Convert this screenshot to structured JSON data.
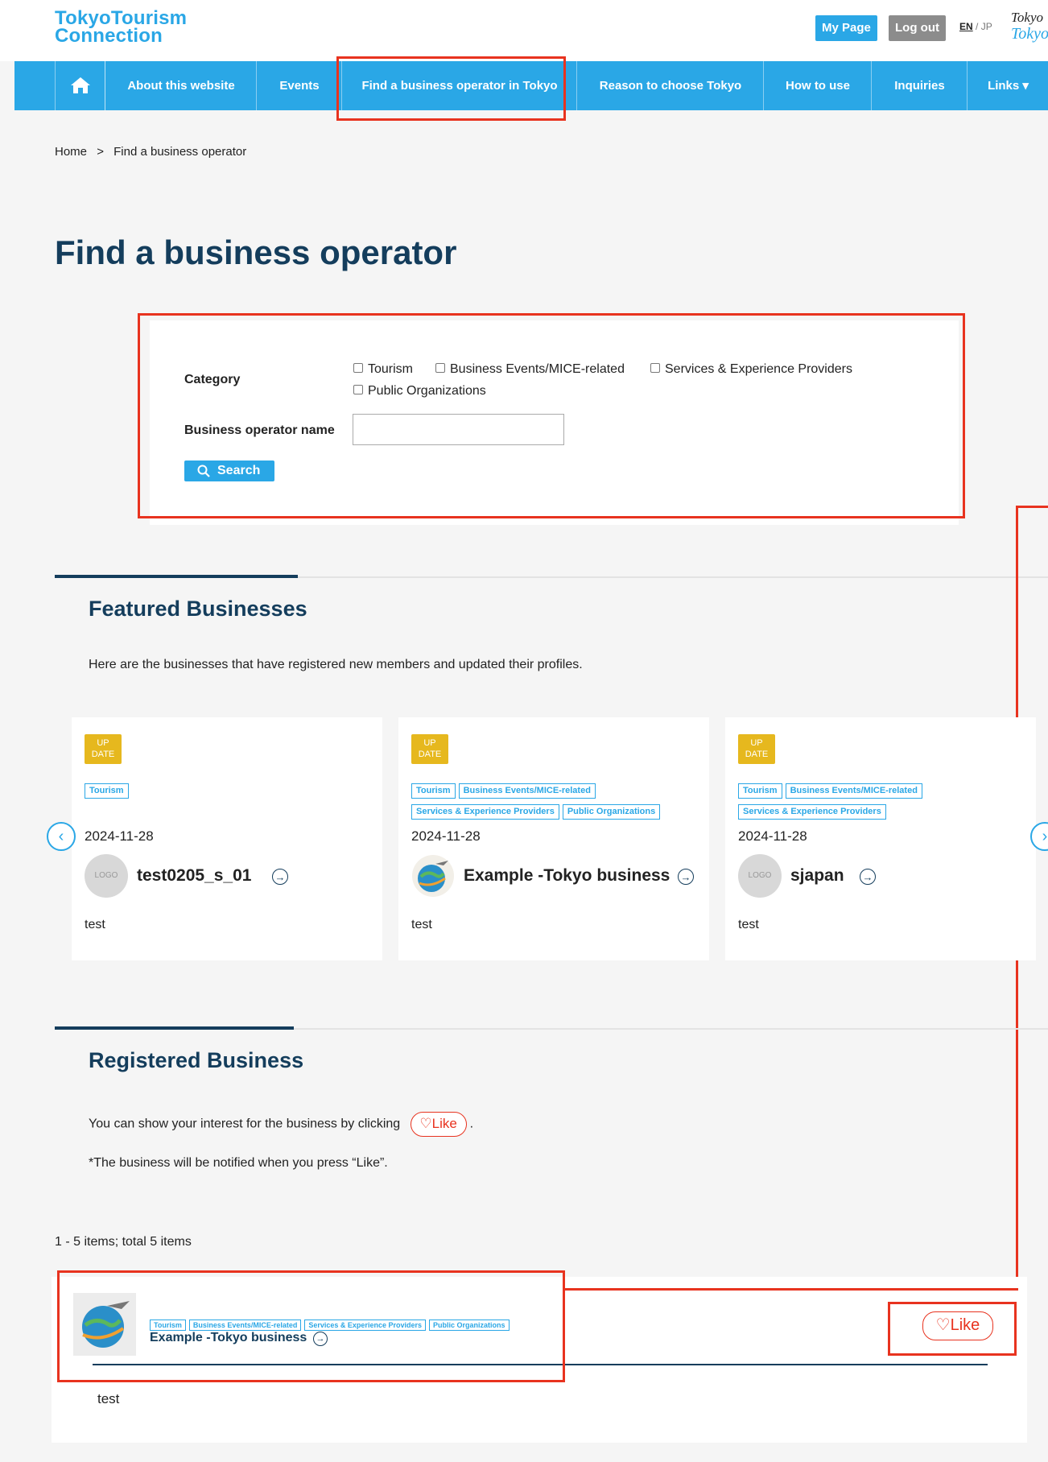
{
  "header": {
    "logo_line1": "TokyoTourism",
    "logo_line2": "Connection",
    "my_page": "My Page",
    "log_out": "Log out",
    "lang_en": "EN",
    "lang_sep": " / ",
    "lang_jp": "JP",
    "partner_logo_line1": "Tokyo",
    "partner_logo_line2": "Tokyo"
  },
  "nav": {
    "home_icon": "home-icon",
    "items": [
      "About this website",
      "Events",
      "Find a business operator in Tokyo",
      "Reason to choose Tokyo",
      "How to use",
      "Inquiries",
      "Links ▾"
    ]
  },
  "breadcrumb": {
    "home": "Home",
    "sep": ">",
    "current": "Find a business operator"
  },
  "page_title": "Find a business operator",
  "search": {
    "category_label": "Category",
    "categories": [
      "Tourism",
      "Business Events/MICE-related",
      "Services & Experience Providers",
      "Public Organizations"
    ],
    "name_label": "Business operator name",
    "name_value": "",
    "button_label": "Search"
  },
  "featured": {
    "title": "Featured Businesses",
    "description": "Here are the businesses that have registered new members and updated their profiles.",
    "badge_line1": "UP",
    "badge_line2": "DATE",
    "cards": [
      {
        "tags": [
          "Tourism"
        ],
        "date": "2024-11-28",
        "name": "test0205_s_01",
        "avatar": "LOGO",
        "text": "test"
      },
      {
        "tags": [
          "Tourism",
          "Business Events/MICE-related",
          "Services & Experience Providers",
          "Public Organizations"
        ],
        "date": "2024-11-28",
        "name": "Example -Tokyo business",
        "avatar": "",
        "text": "test"
      },
      {
        "tags": [
          "Tourism",
          "Business Events/MICE-related",
          "Services & Experience Providers"
        ],
        "date": "2024-11-28",
        "name": "sjapan",
        "avatar": "LOGO",
        "text": "test"
      }
    ],
    "prev_icon": "‹",
    "next_icon": "›"
  },
  "registered": {
    "title": "Registered Business",
    "desc_before": "You can show your interest for the business by clicking",
    "desc_after": ".",
    "like_label": "Like",
    "note": "*The business will be notified when you press “Like”.",
    "count": "1 - 5 items; total 5 items",
    "item": {
      "tags": [
        "Tourism",
        "Business Events/MICE-related",
        "Services & Experience Providers",
        "Public Organizations"
      ],
      "name": "Example -Tokyo business",
      "text": "test",
      "like_label": "Like"
    }
  },
  "colors": {
    "accent": "#2aa7e6",
    "navy": "#143d5c",
    "annotation_red": "#e8331f",
    "badge_yellow": "#e6b81e"
  }
}
